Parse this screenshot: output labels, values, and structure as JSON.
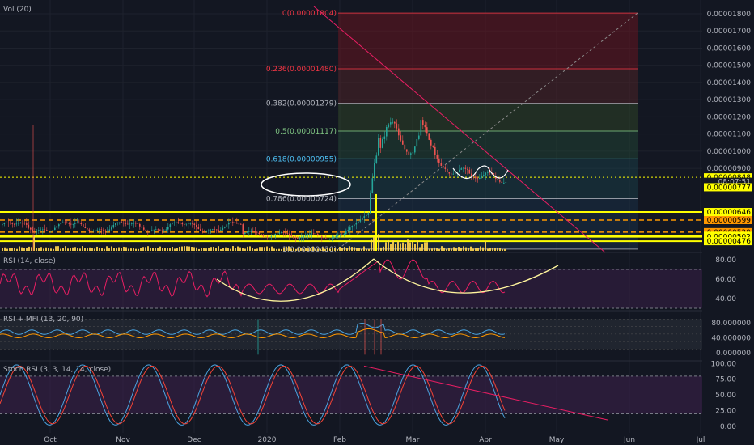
{
  "colors": {
    "bg": "#131722",
    "axis_text": "#b2b5be",
    "grid": "#1e222d",
    "candle_up": "#26a69a",
    "candle_down": "#ef5350",
    "yellow": "#ffff00",
    "orange": "#ff9800",
    "fib_text_colors": [
      "#f23645",
      "#f23645",
      "#b2b5be",
      "#81c784",
      "#4fc3f7",
      "#b2b5be",
      "#b2b5be"
    ],
    "trend_red": "#e91e63",
    "fib_diag": "#888888",
    "rsi_line": "#e91e63",
    "rsi_band": "#3b1f4a",
    "mfi_orange": "#ff9800",
    "rsi_blue": "#4aa3df",
    "stoch_k": "#4aa3df",
    "stoch_d": "#f44336",
    "stoch_band": "#3b1f4a",
    "curve": "#fffde7"
  },
  "chart_data": [
    {
      "type": "line",
      "panel": "price",
      "title": "Vol (20)",
      "y_axis_labels": [
        "0.00001800",
        "0.00001700",
        "0.00001600",
        "0.00001500",
        "0.00001400",
        "0.00001300",
        "0.00001200",
        "0.00001100",
        "0.00001000",
        "0.00000900"
      ],
      "y_axis_values": [
        1800,
        1700,
        1600,
        1500,
        1400,
        1300,
        1200,
        1100,
        1000,
        900
      ],
      "price_tags": [
        {
          "text": "0.00000848",
          "style": "yellow",
          "value": 848
        },
        {
          "text": "08:07:51",
          "style": "dark",
          "value": 822
        },
        {
          "text": "0.00000777",
          "style": "yellow",
          "value": 790
        },
        {
          "text": "0.00000646",
          "style": "yellow",
          "value": 646
        },
        {
          "text": "0.00000599",
          "style": "orange",
          "value": 599
        },
        {
          "text": "0.00000529",
          "style": "orange",
          "value": 529
        },
        {
          "text": "0.00000508",
          "style": "yellow",
          "value": 508
        },
        {
          "text": "0.00000502",
          "style": "yellow",
          "value": 502
        },
        {
          "text": "0.00000476",
          "style": "yellow",
          "value": 476
        }
      ],
      "fib_levels": [
        {
          "label": "0(0.00001804)",
          "value": 1804
        },
        {
          "label": "0.236(0.00001480)",
          "value": 1480
        },
        {
          "label": "0.382(0.00001279)",
          "value": 1279
        },
        {
          "label": "0.5(0.00001117)",
          "value": 1117
        },
        {
          "label": "0.618(0.00000955)",
          "value": 955
        },
        {
          "label": "0.786(0.00000724)",
          "value": 724
        },
        {
          "label": "1(0.00000430)",
          "value": 430
        }
      ],
      "horizontal_levels": [
        {
          "value": 646,
          "style": "solid-yellow"
        },
        {
          "value": 599,
          "style": "dashed-orange"
        },
        {
          "value": 529,
          "style": "dashed-orange"
        },
        {
          "value": 508,
          "style": "solid-yellow"
        },
        {
          "value": 502,
          "style": "solid-yellow"
        },
        {
          "value": 476,
          "style": "solid-yellow"
        },
        {
          "value": 848,
          "style": "dotted-yellow"
        }
      ],
      "ylim": [
        420,
        1850
      ],
      "x_axis_labels": [
        "Oct",
        "Nov",
        "Dec",
        "2020",
        "Feb",
        "Mar",
        "Apr",
        "May",
        "Jun",
        "Jul"
      ]
    },
    {
      "type": "line",
      "panel": "rsi",
      "title": "RSI (14, close)",
      "y_axis_labels": [
        "80.00",
        "60.00",
        "40.00"
      ],
      "y_axis_values": [
        80,
        60,
        40
      ],
      "ylim": [
        25,
        92
      ]
    },
    {
      "type": "line",
      "panel": "rsi_mfi",
      "title": "RSI + MFI (13, 20, 90)",
      "y_axis_labels": [
        "80.000000",
        "40.000000",
        "0.000000"
      ],
      "y_axis_values": [
        80,
        40,
        0
      ],
      "ylim": [
        -10,
        100
      ]
    },
    {
      "type": "line",
      "panel": "stoch_rsi",
      "title": "Stoch RSI (3, 3, 14, 14, close)",
      "y_axis_labels": [
        "100.00",
        "75.00",
        "50.00",
        "25.00",
        "0.00"
      ],
      "y_axis_values": [
        100,
        75,
        50,
        25,
        0
      ],
      "ylim": [
        -5,
        102
      ]
    }
  ]
}
